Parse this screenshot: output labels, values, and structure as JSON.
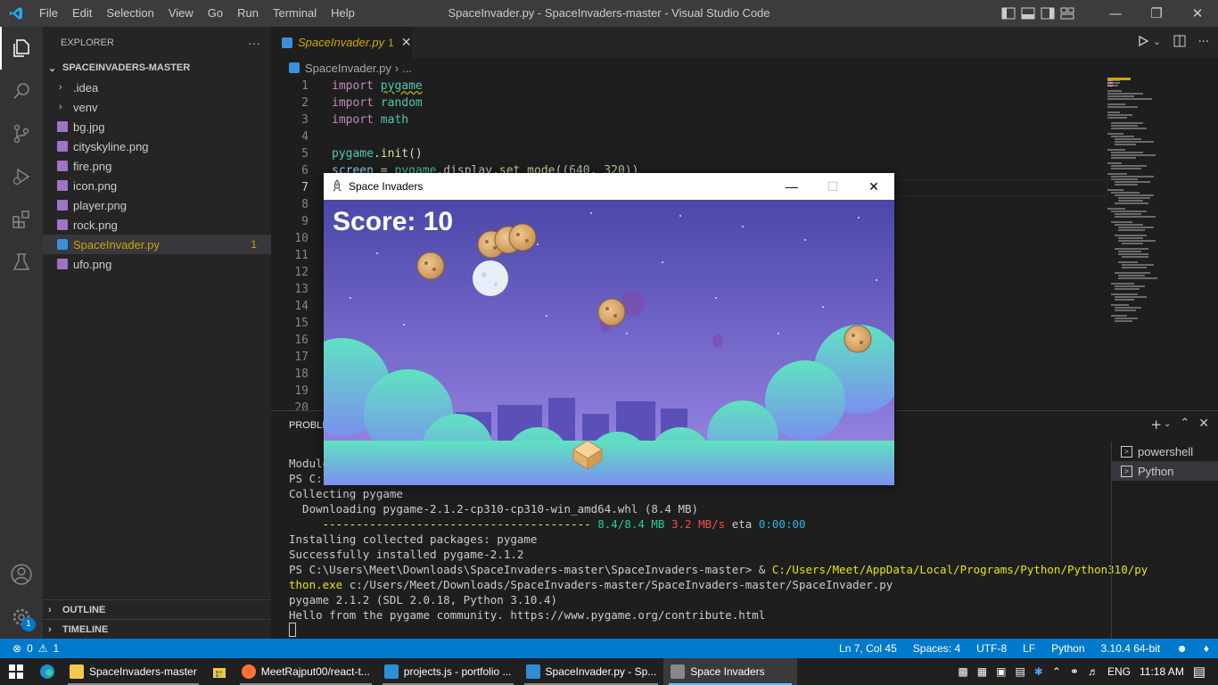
{
  "titlebar": {
    "menu": [
      "File",
      "Edit",
      "Selection",
      "View",
      "Go",
      "Run",
      "Terminal",
      "Help"
    ],
    "title": "SpaceInvader.py - SpaceInvaders-master - Visual Studio Code"
  },
  "sidebar": {
    "header": "EXPLORER",
    "more": "···",
    "root": "SPACEINVADERS-MASTER",
    "folders": [
      ".idea",
      "venv"
    ],
    "files": [
      "bg.jpg",
      "cityskyline.png",
      "fire.png",
      "icon.png",
      "player.png",
      "rock.png",
      "SpaceInvader.py",
      "ufo.png"
    ],
    "selected_count": "1",
    "outline": "OUTLINE",
    "timeline": "TIMELINE"
  },
  "activity": {
    "settings_badge": "1"
  },
  "editor": {
    "tab_name": "SpaceInvader.py",
    "tab_count": "1",
    "breadcrumb_file": "SpaceInvader.py",
    "breadcrumb_more": "...",
    "line_numbers": [
      "1",
      "2",
      "3",
      "4",
      "5",
      "6",
      "7",
      "8",
      "9",
      "10",
      "11",
      "12",
      "13",
      "14",
      "15",
      "16",
      "17",
      "18",
      "19",
      "20"
    ],
    "code": {
      "l1_kw": "import",
      "l1_mod": "pygame",
      "l2_kw": "import",
      "l2_mod": "random",
      "l3_kw": "import",
      "l3_mod": "math",
      "l5_a": "pygame",
      "l5_b": ".",
      "l5_fn": "init",
      "l5_c": "()",
      "l6_var": "screen",
      "l6_eq": " = ",
      "l6_a": "pygame",
      "l6_b": ".display.",
      "l6_fn": "set_mode",
      "l6_c": "((",
      "l6_n1": "640",
      "l6_d": ", ",
      "l6_n2": "320",
      "l6_e": "))"
    }
  },
  "panel": {
    "tab": "PROBLE",
    "terminal": {
      "l1": "Module",
      "l2": "PS C:\\",
      "l3": "Collecting pygame",
      "l4": "  Downloading pygame-2.1.2-cp310-cp310-win_amd64.whl (8.4 MB)",
      "l5_bar": "     ----------------------------------------",
      "l5_size": "8.4/8.4 MB",
      "l5_speed": "3.2 MB/s",
      "l5_eta": "eta",
      "l5_time": "0:00:00",
      "l6": "Installing collected packages: pygame",
      "l7": "Successfully installed pygame-2.1.2",
      "l8_prompt": "PS C:\\Users\\Meet\\Downloads\\SpaceInvaders-master\\SpaceInvaders-master> & ",
      "l8_path": "C:/Users/Meet/AppData/Local/Programs/Python/Python310/py",
      "l9_path": "thon.exe",
      "l9_rest": " c:/Users/Meet/Downloads/SpaceInvaders-master/SpaceInvaders-master/SpaceInvader.py",
      "l10": "pygame 2.1.2 (SDL 2.0.18, Python 3.10.4)",
      "l11": "Hello from the pygame community. https://www.pygame.org/contribute.html"
    },
    "terminals": [
      "powershell",
      "Python"
    ]
  },
  "statusbar": {
    "errors": "0",
    "warnings": "1",
    "position": "Ln 7, Col 45",
    "spaces": "Spaces: 4",
    "encoding": "UTF-8",
    "eol": "LF",
    "language": "Python",
    "interpreter": "3.10.4 64-bit"
  },
  "game": {
    "title": "Space Invaders",
    "score": "Score: 10"
  },
  "taskbar": {
    "apps": [
      {
        "label": "SpaceInvaders-master",
        "color": "#f2c94c"
      },
      {
        "label": "MeetRajput00/react-t...",
        "color": "#ff7139"
      },
      {
        "label": "projects.js - portfolio ...",
        "color": "#2d8fd5"
      },
      {
        "label": "SpaceInvader.py - Sp...",
        "color": "#2d8fd5"
      },
      {
        "label": "Space Invaders",
        "color": "#888888"
      }
    ],
    "lang": "ENG",
    "time": "11:18 AM"
  },
  "colors": {
    "accent": "#007acc",
    "warning": "#cca700"
  }
}
